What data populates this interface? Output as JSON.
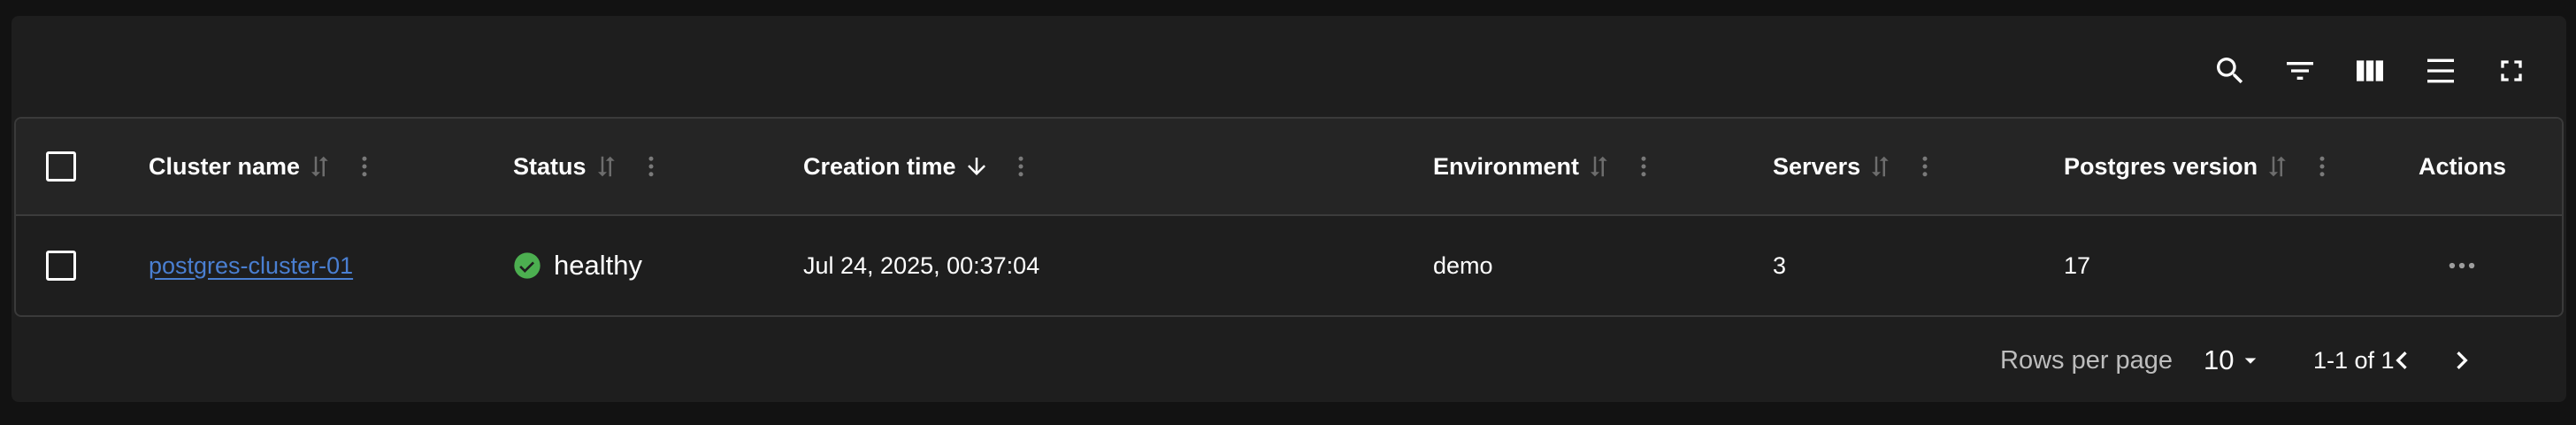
{
  "toolbar": {
    "icons": [
      "search-icon",
      "filter-icon",
      "columns-icon",
      "density-icon",
      "fullscreen-icon"
    ]
  },
  "table": {
    "columns": [
      {
        "label": "Cluster name",
        "sort": "none"
      },
      {
        "label": "Status",
        "sort": "none"
      },
      {
        "label": "Creation time",
        "sort": "desc"
      },
      {
        "label": "Environment",
        "sort": "none"
      },
      {
        "label": "Servers",
        "sort": "none"
      },
      {
        "label": "Postgres version",
        "sort": "none"
      },
      {
        "label": "Actions",
        "sort": "none"
      }
    ],
    "rows": [
      {
        "cluster_name": "postgres-cluster-01",
        "status": "healthy",
        "creation_time": "Jul 24, 2025, 00:37:04",
        "environment": "demo",
        "servers": "3",
        "postgres_version": "17"
      }
    ]
  },
  "footer": {
    "rows_per_page_label": "Rows per page",
    "rows_per_page_value": "10",
    "range": "1-1 of 1"
  },
  "colors": {
    "link": "#4a7fd1",
    "healthy": "#4caf50",
    "background": "#1e1e1e"
  }
}
